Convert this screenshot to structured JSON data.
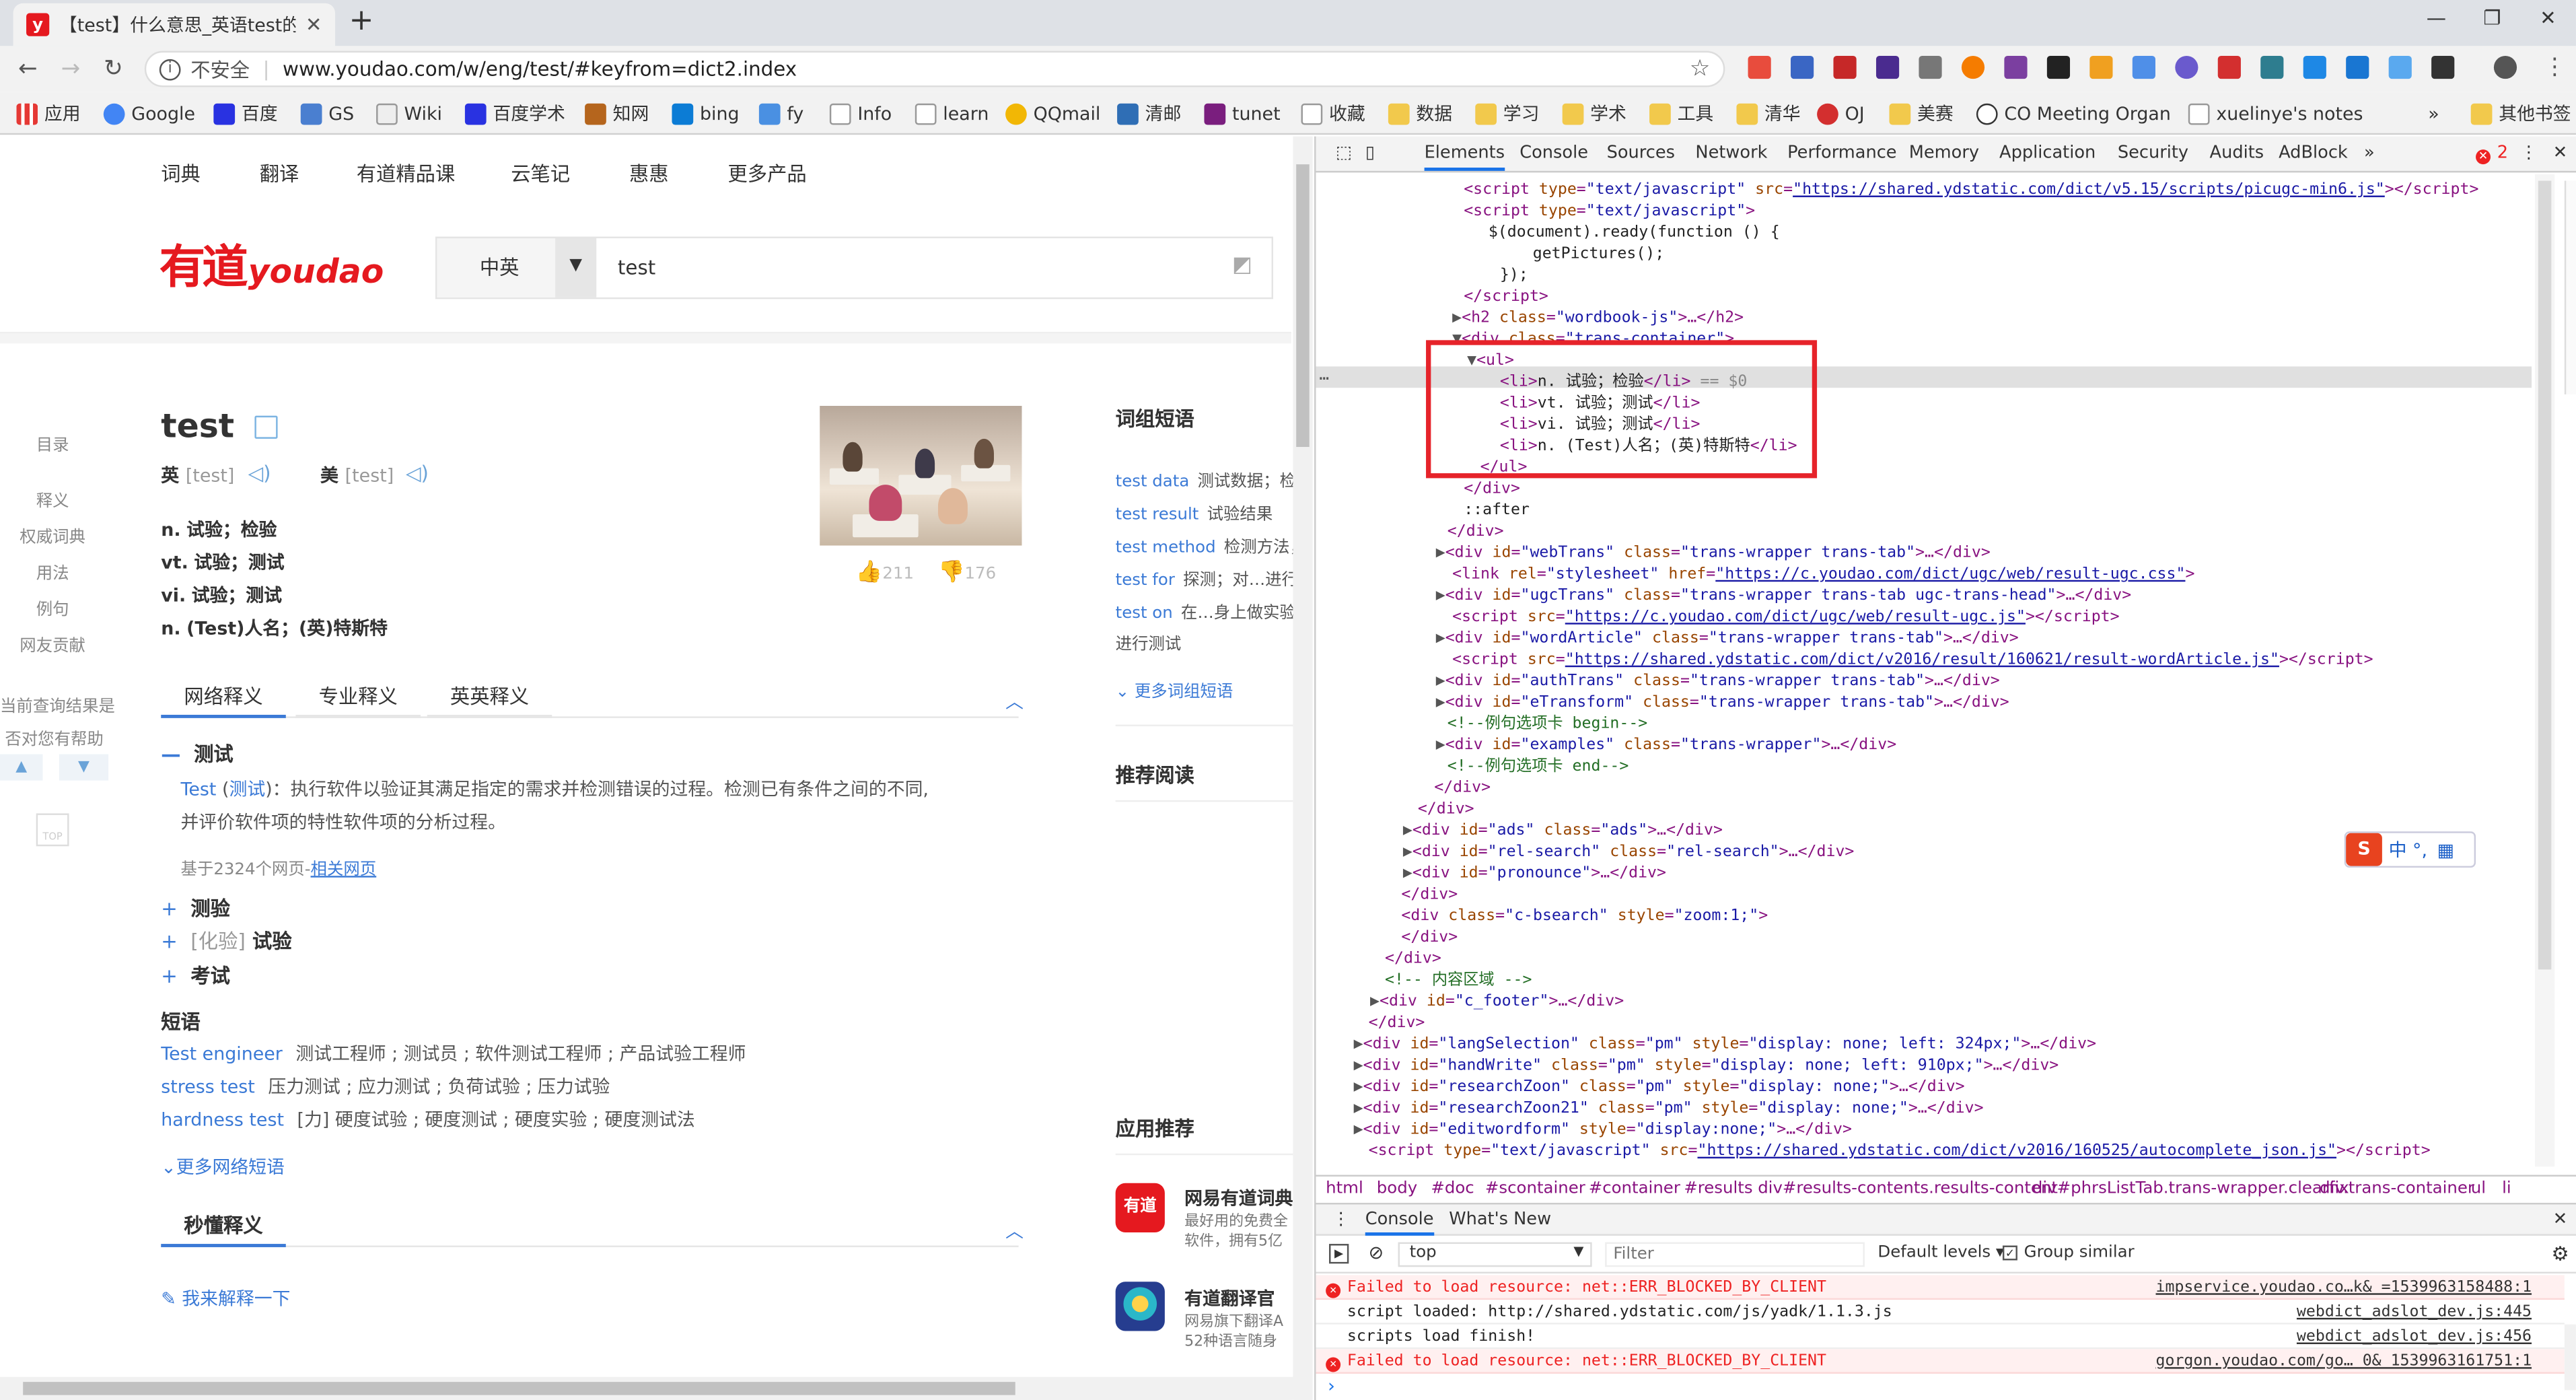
{
  "browser": {
    "tab_title": "【test】什么意思_英语test的翻",
    "tab_favicon": "y",
    "url_secure_label": "不安全",
    "url": "www.youdao.com/w/eng/test/#keyfrom=dict2.index",
    "bookmarks": [
      "应用",
      "Google",
      "百度",
      "GS",
      "Wiki",
      "百度学术",
      "知网",
      "bing",
      "fy",
      "Info",
      "learn",
      "QQmail",
      "清邮",
      "tunet",
      "收藏",
      "数据",
      "学习",
      "学术",
      "工具",
      "清华",
      "OJ",
      "美赛",
      "CO Meeting Organ",
      "xuelinye's notes",
      "其他书签"
    ],
    "overflow": "»"
  },
  "youdao": {
    "nav": [
      "词典",
      "翻译",
      "有道精品课",
      "云笔记",
      "惠惠",
      "更多产品"
    ],
    "logo_cn": "有道",
    "logo_en": "youdao",
    "lang_select": "中英",
    "search_value": "test",
    "sidenav": [
      "目录",
      "释义",
      "权威词典",
      "用法",
      "例句",
      "网友贡献"
    ],
    "side_feedback": [
      "当前查询结果是",
      "否对您有帮助"
    ],
    "side_top": "TOP",
    "word": "test",
    "phon_uk_label": "英",
    "phon_uk": "[test]",
    "phon_us_label": "美",
    "phon_us": "[test]",
    "translations": [
      {
        "pos": "n.",
        "meaning": "试验；检验"
      },
      {
        "pos": "vt.",
        "meaning": "试验；测试"
      },
      {
        "pos": "vi.",
        "meaning": "试验；测试"
      },
      {
        "pos": "n.",
        "meaning": "(Test)人名；(英)特斯特"
      }
    ],
    "likes": "211",
    "dislikes": "176",
    "tabs": [
      "网络释义",
      "专业释义",
      "英英释义"
    ],
    "web_head": "测试",
    "web_def_en": "Test",
    "web_def_cn_link": "测试",
    "web_def_text": "：执行软件以验证其满足指定的需求并检测错误的过程。检测已有条件之间的不同,",
    "web_def_text2": "并评价软件项的特性软件项的分析过程。",
    "web_source_prefix": "基于2324个网页-",
    "web_source_link": "相关网页",
    "more_senses": [
      {
        "tag": "",
        "text": "测验"
      },
      {
        "tag": "[化验]",
        "text": "试验"
      },
      {
        "tag": "",
        "text": "考试"
      }
    ],
    "phrases_head": "短语",
    "phrases": [
      {
        "en": "Test engineer",
        "cn": "测试工程师 ; 测试员 ; 软件测试工程师 ; 产品试验工程师"
      },
      {
        "en": "stress test",
        "cn": "压力测试 ; 应力测试 ; 负荷试验 ; 压力试验"
      },
      {
        "en": "hardness test",
        "cn": "[力] 硬度试验 ; 硬度测试 ; 硬度实验 ; 硬度测试法"
      }
    ],
    "more_web_phrases": "更多网络短语",
    "quick_head": "秒懂释义",
    "explain_link": "我来解释一下",
    "right": {
      "phrase_head": "词组短语",
      "phrases": [
        {
          "en": "test data",
          "cn": "测试数据；检"
        },
        {
          "en": "test result",
          "cn": "试验结果"
        },
        {
          "en": "test method",
          "cn": "检测方法，"
        },
        {
          "en": "test for",
          "cn": "探测；对…进行"
        },
        {
          "en": "test on",
          "cn": "在…身上做实验"
        }
      ],
      "phrase_extra": "进行测试",
      "more_phrases": "更多词组短语",
      "reading_head": "推荐阅读",
      "apps_head": "应用推荐",
      "apps": [
        {
          "title": "网易有道词典",
          "desc1": "最好用的免费全",
          "desc2": "软件，拥有5亿"
        },
        {
          "title": "有道翻译官",
          "desc1": "网易旗下翻译A",
          "desc2": "52种语言随身"
        }
      ]
    }
  },
  "devtools": {
    "tabs": [
      "Elements",
      "Console",
      "Sources",
      "Network",
      "Performance",
      "Memory",
      "Application",
      "Security",
      "Audits",
      "AdBlock"
    ],
    "error_count": "2",
    "breadcrumbs": [
      "html",
      "body",
      "#doc",
      "#scontainer",
      "#container",
      "#results",
      "div#results-contents.results-content",
      "div#phrsListTab.trans-wrapper.clearfix",
      "div.trans-container",
      "ul",
      "li"
    ],
    "console_tabs": [
      "Console",
      "What's New"
    ],
    "context": "top",
    "filter_placeholder": "Filter",
    "levels": "Default levels",
    "group_similar": "Group similar",
    "console_lines": [
      {
        "type": "error",
        "text": "Failed to load resource: net::ERR_BLOCKED_BY_CLIENT",
        "src": "impservice.youdao.co…k& =1539963158488:1"
      },
      {
        "type": "log",
        "text": "script loaded:  http://shared.ydstatic.com/js/yadk/1.1.3.js",
        "src": "webdict_adslot_dev.js:445"
      },
      {
        "type": "log",
        "text": "scripts load finish!",
        "src": "webdict_adslot_dev.js:456"
      },
      {
        "type": "error",
        "text": "Failed to load resource: net::ERR_BLOCKED_BY_CLIENT",
        "src": "gorgon.youdao.com/go… 0& 1539963161751:1"
      }
    ],
    "ime_label": "中 °,"
  }
}
